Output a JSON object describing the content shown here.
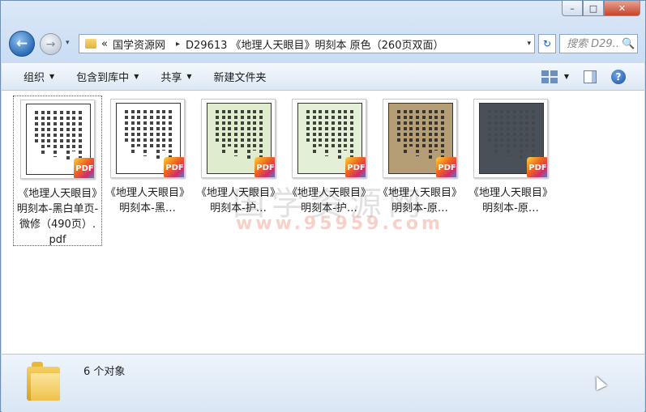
{
  "window": {
    "caption_buttons": {
      "minimize": "–",
      "maximize": "□",
      "close": "✕"
    }
  },
  "nav": {
    "back_icon": "arrow-left-icon",
    "forward_icon": "arrow-right-icon",
    "history_icon": "▾",
    "breadcrumb_prefix": "«",
    "breadcrumbs": [
      "国学资源网",
      "D29613 《地理人天眼目》明刻本 原色（260页双面）"
    ],
    "separator": "▸",
    "dropdown_icon": "▾",
    "refresh_icon": "↻",
    "search_placeholder": "搜索 D29...",
    "search_icon": "🔍"
  },
  "toolbar": {
    "items": [
      {
        "label": "组织",
        "arrow": "▼"
      },
      {
        "label": "包含到库中",
        "arrow": "▼"
      },
      {
        "label": "共享",
        "arrow": "▼"
      },
      {
        "label": "新建文件夹",
        "arrow": ""
      }
    ],
    "views_arrow": "▼",
    "help_label": "?"
  },
  "files": [
    {
      "name": "《地理人天眼目》明刻本-黑白单页-微修（490页）.pdf",
      "badge": "PDF",
      "bg": "#ffffff",
      "selected": true
    },
    {
      "name": "《地理人天眼目》明刻本-黑…",
      "badge": "PDF",
      "bg": "#ffffff",
      "selected": false
    },
    {
      "name": "《地理人天眼目》明刻本-护…",
      "badge": "PDF",
      "bg": "#dfeccd",
      "selected": false
    },
    {
      "name": "《地理人天眼目》明刻本-护…",
      "badge": "PDF",
      "bg": "#e3efd6",
      "selected": false
    },
    {
      "name": "《地理人天眼目》明刻本-原…",
      "badge": "PDF",
      "bg": "#b59d76",
      "selected": false
    },
    {
      "name": "《地理人天眼目》明刻本-原…",
      "badge": "PDF",
      "bg": "#4a5058",
      "selected": false
    }
  ],
  "watermark": {
    "text": "国学资源网",
    "url": "www.95959.com"
  },
  "status": {
    "count": "6 个对象"
  }
}
